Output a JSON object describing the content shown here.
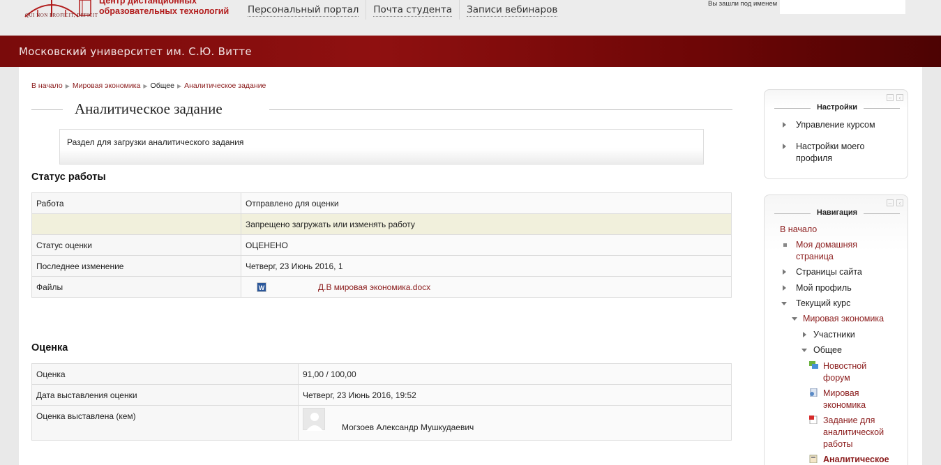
{
  "header": {
    "logo_name_line1": "Центр дистанционных",
    "logo_name_line2": "образовательных технологий",
    "logo_motto": "QUI NON PROFICIT, DEFICIT",
    "nav": [
      "Персональный портал",
      "Почта студента",
      "Записи вебинаров"
    ],
    "login_text": "Вы зашли под именем"
  },
  "banner": {
    "title": "Московский университет им. С.Ю. Витте"
  },
  "breadcrumb": [
    "В начало",
    "Мировая экономика",
    "Общее",
    "Аналитическое задание"
  ],
  "page_title": "Аналитическое задание",
  "intro": "Раздел для загрузки аналитического задания",
  "status_section": {
    "title": "Статус работы",
    "rows": [
      {
        "label": "Работа",
        "value": "Отправлено для оценки"
      },
      {
        "label": "",
        "value": "Запрещено загружать или изменять работу"
      },
      {
        "label": "Статус оценки",
        "value": "ОЦЕНЕНО"
      },
      {
        "label": "Последнее изменение",
        "value": "Четверг, 23 Июнь 2016, 1"
      },
      {
        "label": "Файлы",
        "value": "Д.В мировая экономика.docx"
      }
    ]
  },
  "grade_section": {
    "title": "Оценка",
    "rows": [
      {
        "label": "Оценка",
        "value": "91,00 / 100,00"
      },
      {
        "label": "Дата выставления оценки",
        "value": "Четверг, 23 Июнь 2016, 19:52"
      },
      {
        "label": "Оценка выставлена (кем)",
        "value": "Могзоев Александр Мушкудаевич"
      }
    ]
  },
  "settings_block": {
    "title": "Настройки",
    "items": [
      "Управление курсом",
      "Настройки моего профиля"
    ]
  },
  "nav_block": {
    "title": "Навигация",
    "home": "В начало",
    "items": {
      "my_home": "Моя домашняя страница",
      "site_pages": "Страницы сайта",
      "my_profile": "Мой профиль",
      "current_course": "Текущий курс",
      "course": "Мировая экономика",
      "participants": "Участники",
      "general": "Общее",
      "news_forum": "Новостной форум",
      "world_economy": "Мировая экономика",
      "task": "Задание для аналитической работы",
      "analytic": "Аналитическое"
    }
  },
  "colors": {
    "banner": "#8f1010",
    "link": "#8a1a1a",
    "warn_row": "#f1f0dc"
  }
}
